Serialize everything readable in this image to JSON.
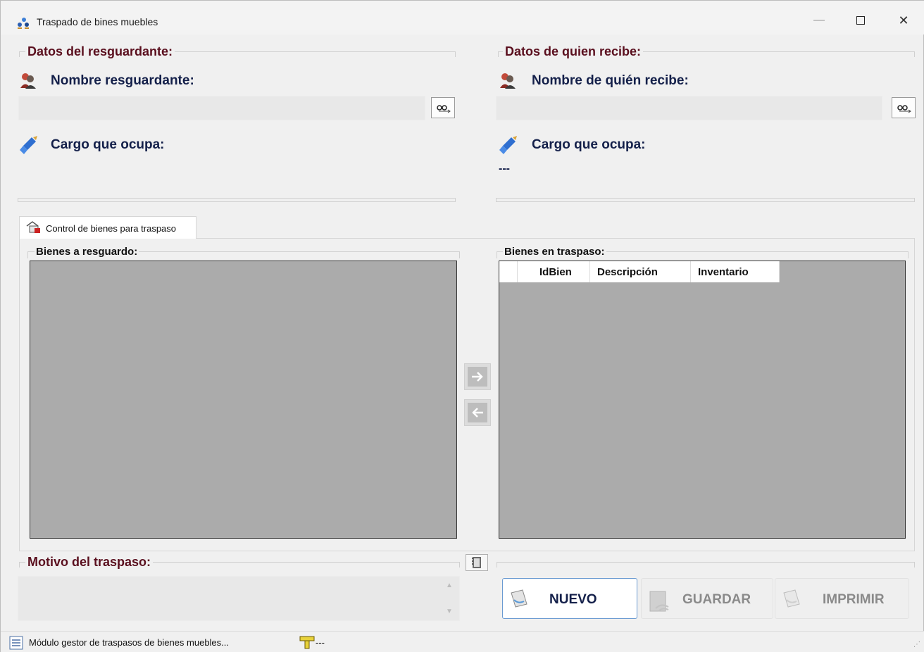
{
  "window": {
    "title": "Traspado de bines muebles",
    "icon": "users-transfer-icon"
  },
  "resguardante": {
    "group_title": "Datos del resguardante:",
    "name_label": "Nombre resguardante:",
    "name_value": "",
    "cargo_label": "Cargo que ocupa:",
    "cargo_value": ""
  },
  "recibe": {
    "group_title": "Datos de quien recibe:",
    "name_label": "Nombre de quién recibe:",
    "name_value": "",
    "cargo_label": "Cargo que ocupa:",
    "cargo_value": "---"
  },
  "tab": {
    "label": "Control de bienes para traspaso"
  },
  "bienes_resguardo": {
    "title": "Bienes a resguardo:"
  },
  "bienes_traspaso": {
    "title": "Bienes en traspaso:",
    "columns": [
      "IdBien",
      "Descripción",
      "Inventario"
    ]
  },
  "motivo": {
    "title": "Motivo del traspaso:",
    "value": ""
  },
  "actions": {
    "nuevo": "NUEVO",
    "guardar": "GUARDAR",
    "imprimir": "IMPRIMIR"
  },
  "status": {
    "message": "Módulo gestor de traspasos de bienes muebles...",
    "secondary": "---"
  },
  "colors": {
    "group_title": "#5a0f1e",
    "field_label": "#14204a",
    "grid_bg": "#ababab",
    "primary_border": "#6b9bd2"
  }
}
